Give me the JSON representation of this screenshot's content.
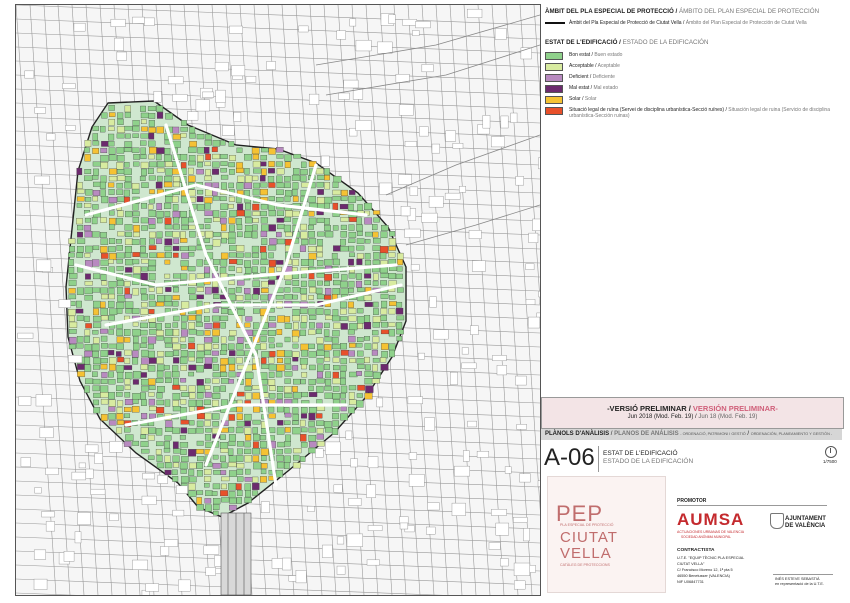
{
  "legend": {
    "ambit_title": "ÀMBIT DEL PLA ESPECIAL DE PROTECCIÓ",
    "ambit_title_alt": "ÁMBITO DEL PLAN ESPECIAL DE PROTECCIÓN",
    "ambit_line_label": "Àmbit del Pla Especial de Protecció de Ciutat Vella",
    "ambit_line_label_alt": "Ámbito del Plan Especial de Protección de Ciutat Vella",
    "estat_title": "ESTAT DE L'EDIFICACIÓ",
    "estat_title_alt": "ESTADO DE LA EDIFICACIÓN",
    "items": [
      {
        "label": "Bon estat",
        "alt": "Buen estado",
        "color": "#8fd18b"
      },
      {
        "label": "Acceptable",
        "alt": "Aceptable",
        "color": "#d8eba0"
      },
      {
        "label": "Deficient",
        "alt": "Deficiente",
        "color": "#b88ac0"
      },
      {
        "label": "Mal estat",
        "alt": "Mal estado",
        "color": "#6c2a6e"
      },
      {
        "label": "Solar",
        "alt": "Solar",
        "color": "#f5c233"
      },
      {
        "label": "Situació legal de ruïna (Servei de disciplina urbanística-Secció ruïnes)",
        "alt": "Situación legal de ruina (Servicio de disciplina urbanística-Sección ruinas)",
        "color": "#e8502a"
      }
    ]
  },
  "version": {
    "title": "-VERSIÓ PRELIMINAR",
    "title_alt": "VERSIÓN PRELIMINAR-",
    "date": "Jun 2018 (Mod. Feb. 19)",
    "date_alt": "Jun 18 (Mod. Feb. 19)"
  },
  "planols": {
    "title": "PLÀNOLS D'ANÀLISIS",
    "title_alt": "PLANOS DE ANÁLISIS",
    "sub": "- ORDENACIÓ, PATRIMONI I GESTIÓ",
    "sub_alt": "ORDENACIÓN, PLANEAMIENTO Y GESTIÓN -"
  },
  "plan": {
    "code": "A-06",
    "title": "ESTAT DE L'EDIFICACIÓ",
    "title_alt": "ESTADO DE LA EDIFICACIÓN",
    "scale": "1/7500"
  },
  "pep": {
    "big": "PEP",
    "sub": "PLA ESPECIAL DE PROTECCIÓ",
    "ciutat": "CIUTAT",
    "vella": "VELLA",
    "cat": "CATÀLEG DE PROTECCIONS"
  },
  "promotor": {
    "label": "PROMOTOR",
    "aumsa": "AUMSA",
    "aumsa_sub": "ACTUACIONES URBANAS DE VALENCIA",
    "aumsa_sub2": "SOCIEDAD ANÓNIMA MUNICIPAL",
    "ajuntament": "AJUNTAMENT",
    "ajuntament2": "DE VALÈNCIA"
  },
  "contractista": {
    "label": "CONTRACTISTA",
    "lines": [
      "U.T.E. \"EQUIP TÈCNIC PLA ESPECIAL",
      "CIUTAT VELLA\"",
      "C/ Francisco Moreno 12, 1ª pta 5",
      "46550 Benetusser (VALENCIA)",
      "NIF U06847731"
    ],
    "sign1": "INÉS ESTEVE SEBASTIÀ",
    "sign2": "en representació de la U.T.E."
  }
}
